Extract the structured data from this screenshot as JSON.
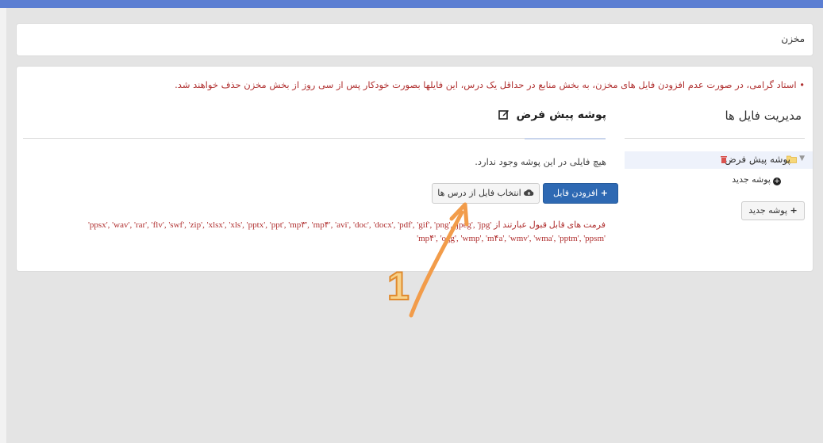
{
  "breadcrumb": {
    "label": "مخزن"
  },
  "notice": "• استاد گرامی، در صورت عدم افزودن فایل های مخزن، به بخش منابع در حداقل یک درس، این فایلها بصورت خودکار پس از سی روز از بخش مخزن حذف خواهند شد.",
  "file_manager": {
    "title": "مدیریت فایل ها",
    "tree": [
      {
        "label": "پوشه پیش فرض"
      }
    ],
    "new_folder_link": "پوشه جدید",
    "new_folder_button": "پوشه جدید"
  },
  "folder_view": {
    "title": "پوشه پیش فرض",
    "empty_message": "هیچ فایلی در این پوشه وجود ندارد.",
    "add_file_button": "افزودن فایل",
    "select_from_courses_button": "انتخاب فایل از درس ها",
    "formats_line1": "فرمت های قابل قبول عبارتند از 'ppsx', 'wav', 'rar', 'flv', 'swf', 'zip', 'xlsx', 'xls', 'pptx', 'ppt', 'mp۳', 'mp۴', 'avi', 'doc', 'docx', 'pdf', 'gif', 'png', 'jpeg', 'jpg'",
    "formats_line2": "'mp۴', 'ogg', 'wmp', 'm۴a', 'wmv', 'wma', 'pptm', 'ppsm'"
  },
  "annotation": {
    "number": "1"
  },
  "colors": {
    "primary": "#2e69b3",
    "notice": "#b03030",
    "accent_bar": "#5b7ed2",
    "annotation": "#f29c4a"
  },
  "icons": [
    "edit-icon",
    "folder-icon",
    "trash-icon",
    "plus-circle-icon",
    "plus-icon",
    "cloud-upload-icon",
    "caret-down-icon",
    "arrow-icon"
  ]
}
